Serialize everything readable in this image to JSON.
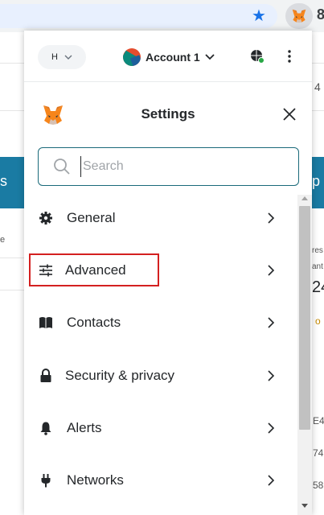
{
  "browser": {
    "star_icon": "star-icon",
    "extension_icon": "metamask-fox-icon",
    "edge_text": "8"
  },
  "background_page": {
    "left_banner_text": "s",
    "right_banner_text": "p",
    "fragments": [
      "4",
      "e",
      "res",
      "ant",
      "24",
      "o",
      "E4",
      "74",
      "58"
    ]
  },
  "header": {
    "network_label": "H",
    "account_name": "Account 1",
    "account_icon": "account-avatar",
    "globe_icon": "globe-icon",
    "menu_icon": "kebab-menu-icon"
  },
  "settings": {
    "title": "Settings",
    "close_icon": "close-icon",
    "search_placeholder": "Search",
    "items": [
      {
        "label": "General",
        "icon": "gear-icon"
      },
      {
        "label": "Advanced",
        "icon": "sliders-icon"
      },
      {
        "label": "Contacts",
        "icon": "book-icon"
      },
      {
        "label": "Security & privacy",
        "icon": "lock-icon"
      },
      {
        "label": "Alerts",
        "icon": "bell-icon"
      },
      {
        "label": "Networks",
        "icon": "plug-icon"
      }
    ]
  },
  "colors": {
    "accent_teal": "#1a6a7a",
    "highlight_red": "#d42020",
    "text_primary": "#24272a",
    "banner": "#1a7ba3"
  }
}
